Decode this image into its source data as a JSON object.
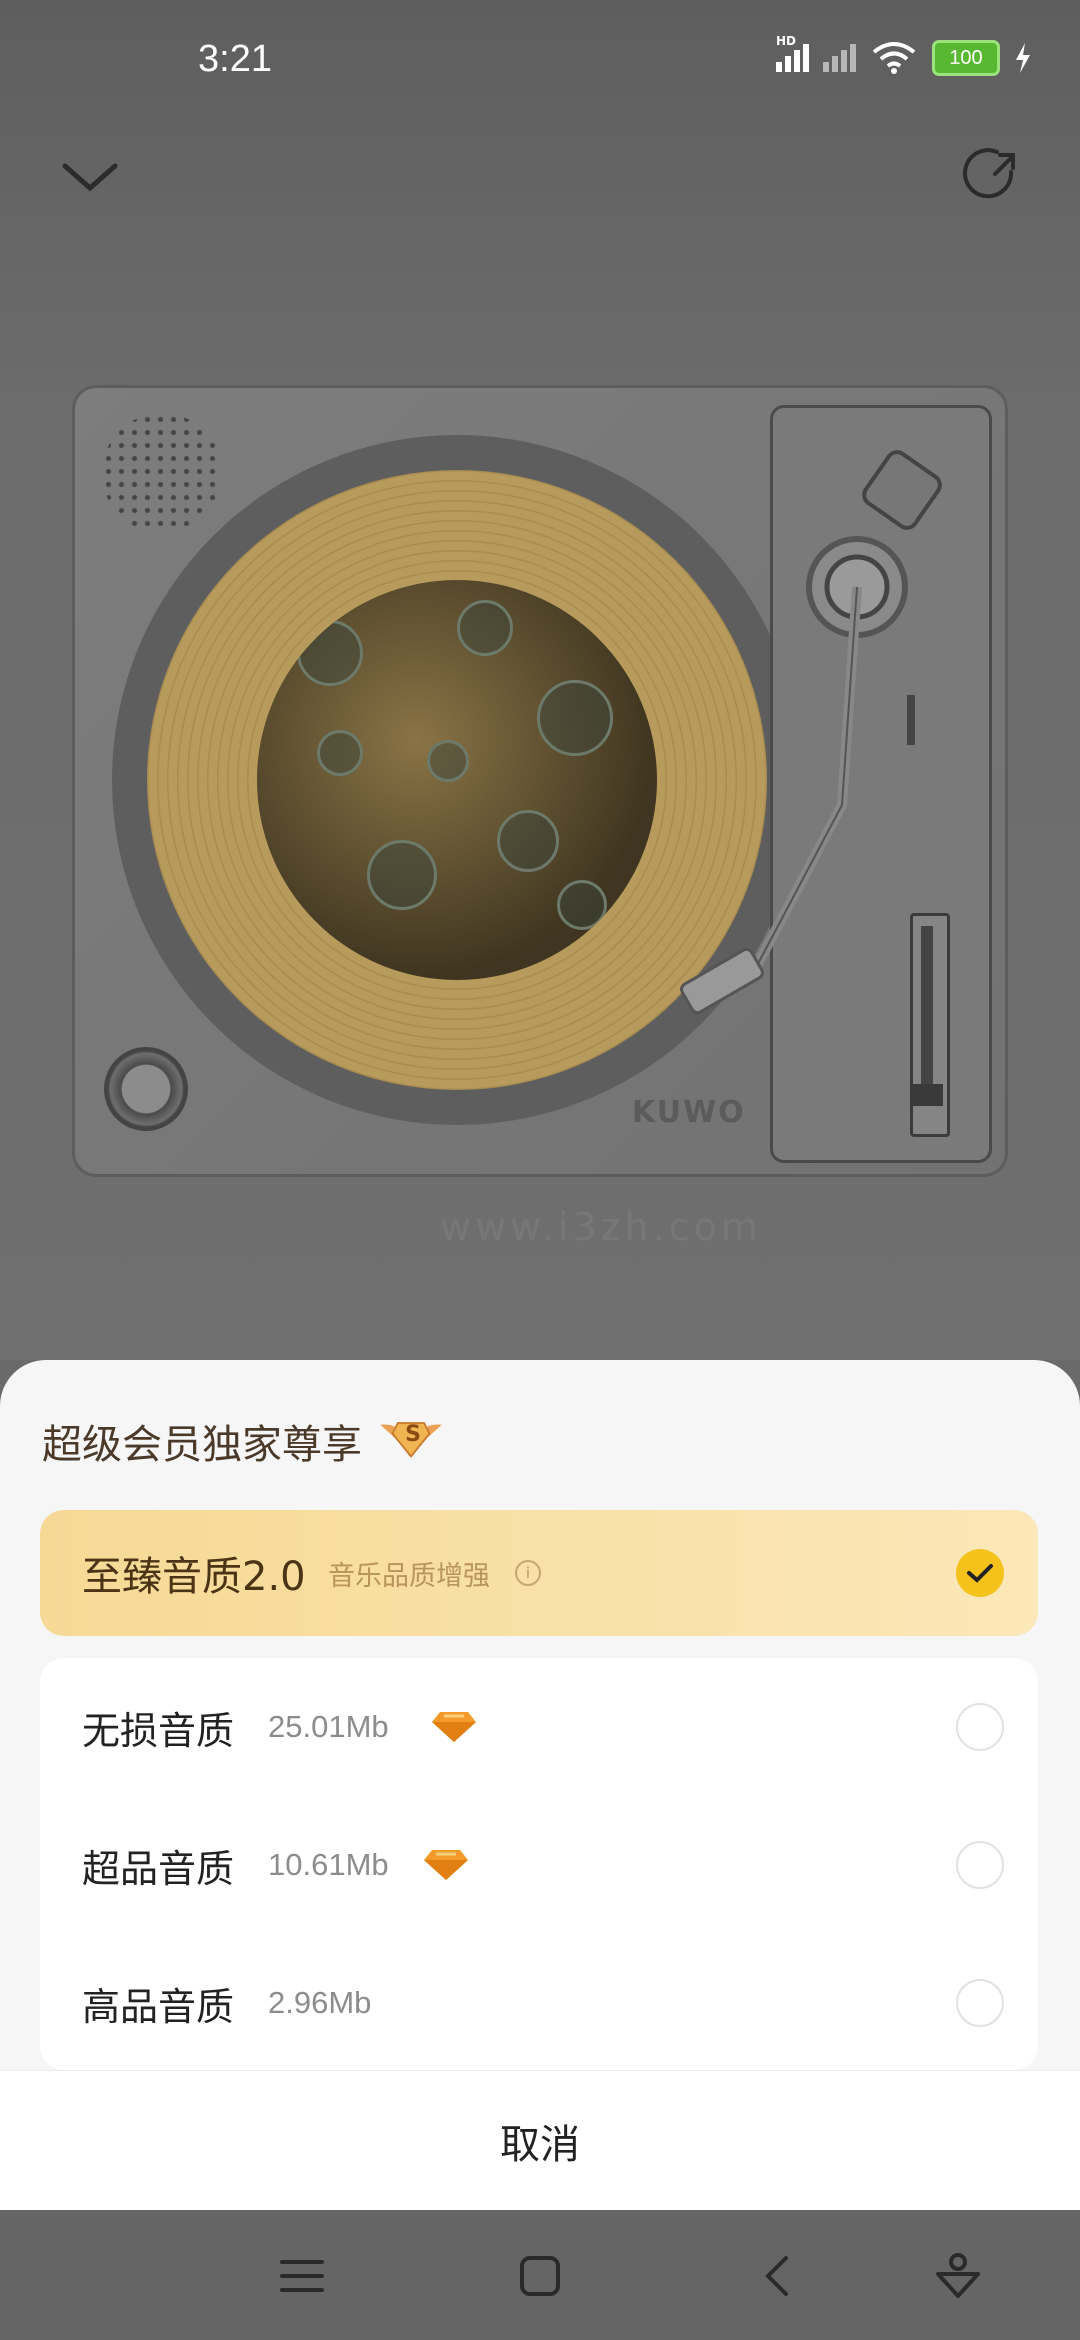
{
  "status_bar": {
    "time": "3:21",
    "network_label": "HD",
    "battery": "100"
  },
  "player": {
    "brand_text": "KUWO",
    "watermark": "www.i3zh.com"
  },
  "quality_sheet": {
    "title": "超级会员独家尊享",
    "badge_letter": "S",
    "selected_option": {
      "label": "至臻音质2.0",
      "description": "音乐品质增强",
      "info_icon": "i"
    },
    "options": [
      {
        "label": "无损音质",
        "size": "25.01Mb",
        "vip": true
      },
      {
        "label": "超品音质",
        "size": "10.61Mb",
        "vip": true
      },
      {
        "label": "高品音质",
        "size": "2.96Mb",
        "vip": false
      }
    ],
    "cancel_label": "取消"
  },
  "colors": {
    "accent": "#f4c21b",
    "selected_bg": "#f6d995",
    "diamond": "#f39a2a"
  }
}
